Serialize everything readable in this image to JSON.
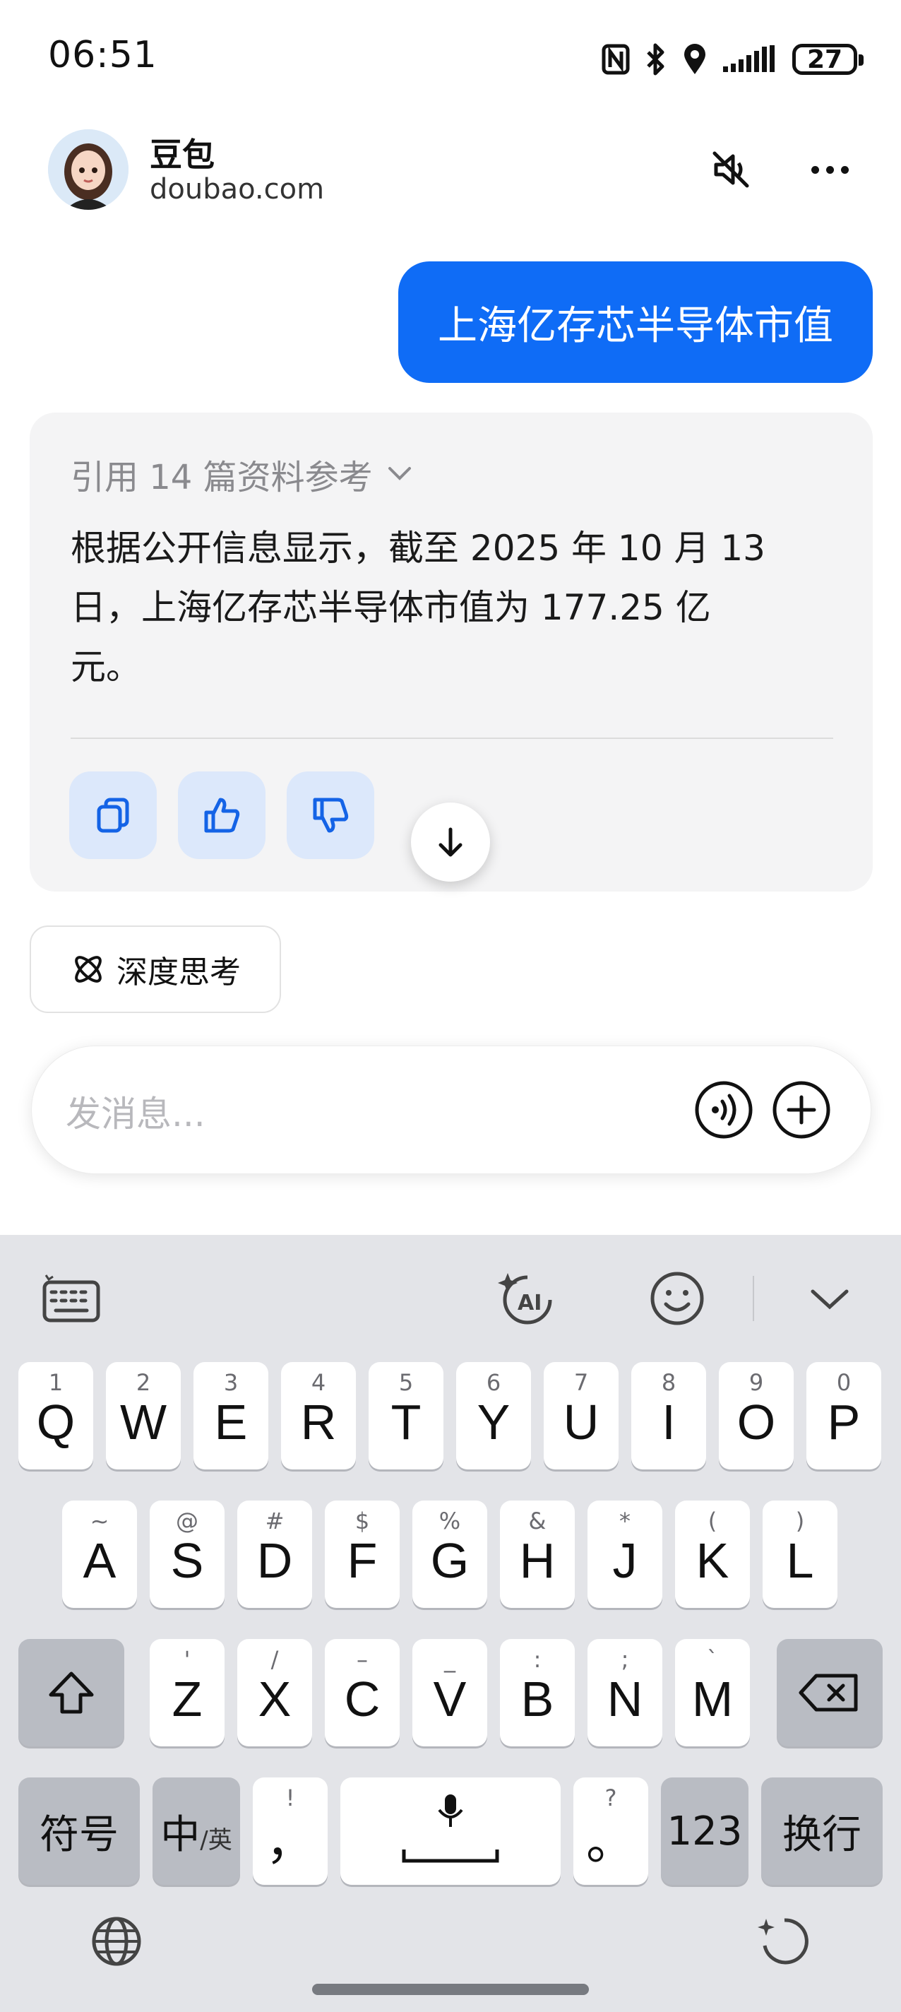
{
  "status_bar": {
    "time": "06:51",
    "battery": "27"
  },
  "header": {
    "bot_name": "豆包",
    "bot_domain": "doubao.com"
  },
  "chat": {
    "user_message": "上海亿存芯半导体市值",
    "references_label": "引用 14 篇资料参考",
    "answer_lines": [
      "根据公开信息显示，截至 2025 年 10 月 13",
      "日，上海亿存芯半导体市值为 177.25 亿",
      "元。"
    ]
  },
  "chips": {
    "deep_think": "深度思考"
  },
  "input": {
    "placeholder": "发消息..."
  },
  "keyboard": {
    "row1": [
      {
        "main": "Q",
        "sub": "1"
      },
      {
        "main": "W",
        "sub": "2"
      },
      {
        "main": "E",
        "sub": "3"
      },
      {
        "main": "R",
        "sub": "4"
      },
      {
        "main": "T",
        "sub": "5"
      },
      {
        "main": "Y",
        "sub": "6"
      },
      {
        "main": "U",
        "sub": "7"
      },
      {
        "main": "I",
        "sub": "8"
      },
      {
        "main": "O",
        "sub": "9"
      },
      {
        "main": "P",
        "sub": "0"
      }
    ],
    "row2": [
      {
        "main": "A",
        "sub": "~"
      },
      {
        "main": "S",
        "sub": "@"
      },
      {
        "main": "D",
        "sub": "#"
      },
      {
        "main": "F",
        "sub": "$"
      },
      {
        "main": "G",
        "sub": "%"
      },
      {
        "main": "H",
        "sub": "&"
      },
      {
        "main": "J",
        "sub": "*"
      },
      {
        "main": "K",
        "sub": "("
      },
      {
        "main": "L",
        "sub": ")"
      }
    ],
    "row3": [
      {
        "main": "Z",
        "sub": "'"
      },
      {
        "main": "X",
        "sub": "/"
      },
      {
        "main": "C",
        "sub": "–"
      },
      {
        "main": "V",
        "sub": "_"
      },
      {
        "main": "B",
        "sub": ":"
      },
      {
        "main": "N",
        "sub": ";"
      },
      {
        "main": "M",
        "sub": "`"
      }
    ],
    "symbols": "符号",
    "lang_main": "中",
    "lang_sub": "/英",
    "comma": "，",
    "comma_sub": "!",
    "period": "。",
    "period_sub": "?",
    "num": "123",
    "enter": "换行"
  }
}
